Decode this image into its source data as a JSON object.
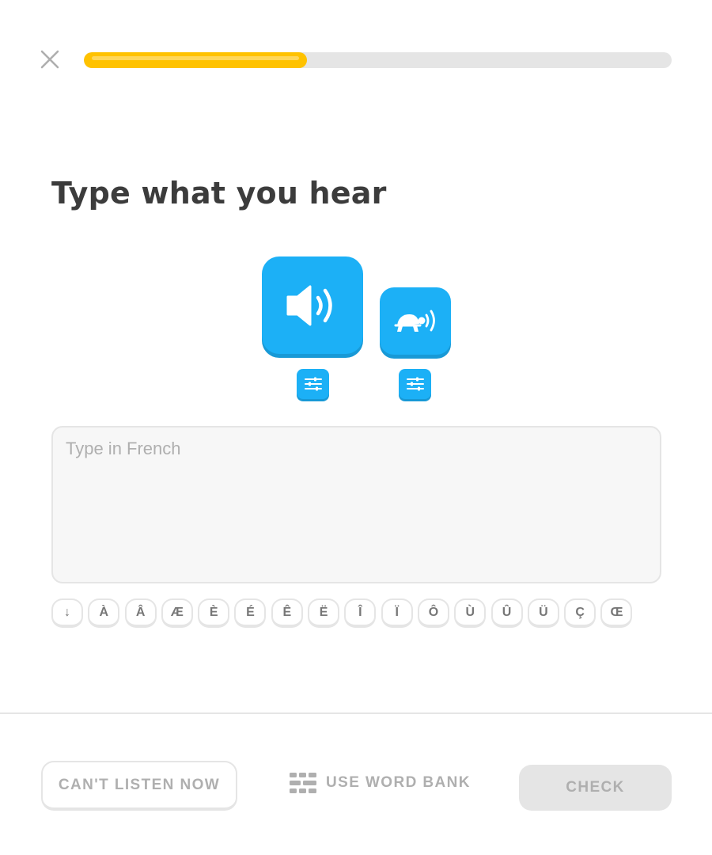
{
  "header": {
    "close_icon": "close-icon",
    "progress_fraction": 0.38,
    "progress_color": "#ffc200"
  },
  "challenge": {
    "title": "Type what you hear",
    "audio_normal_icon": "speaker-icon",
    "audio_slow_icon": "turtle-speaker-icon",
    "settings_icon": "sliders-icon",
    "accent_color": "#1cb0f6"
  },
  "answer": {
    "placeholder": "Type in French",
    "value": ""
  },
  "special_keys": [
    "↓",
    "À",
    "Â",
    "Æ",
    "È",
    "É",
    "Ê",
    "Ë",
    "Î",
    "Ï",
    "Ô",
    "Ù",
    "Û",
    "Ü",
    "Ç",
    "Œ"
  ],
  "footer": {
    "cant_listen_label": "CAN'T LISTEN NOW",
    "word_bank_label": "USE WORD BANK",
    "word_bank_icon": "word-bank-icon",
    "check_label": "CHECK"
  }
}
